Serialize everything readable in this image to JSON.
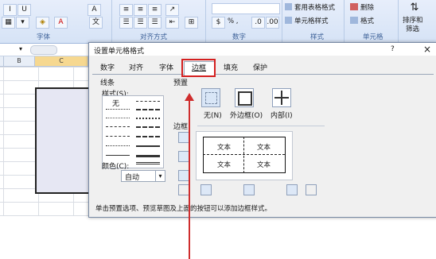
{
  "ribbon": {
    "group_font": "字体",
    "group_align": "对齐方式",
    "group_number": "数字",
    "group_style": "样式",
    "group_cells": "单元格",
    "number_symbols": "% ,",
    "table_format": "套用表格格式",
    "cell_style": "单元格样式",
    "delete": "删除",
    "format": "格式",
    "sort_filter_1": "排序和",
    "sort_filter_2": "筛选"
  },
  "sheet": {
    "name_box": "▾",
    "col_b": "B",
    "col_c": "C"
  },
  "dialog": {
    "title": "设置单元格格式",
    "help": "?",
    "close": "×",
    "tabs": [
      "数字",
      "对齐",
      "字体",
      "边框",
      "填充",
      "保护"
    ],
    "line_section": "线条",
    "style_label": "样式(S):",
    "style_none": "无",
    "color_label": "颜色(C):",
    "color_value": "自动",
    "preset_section": "预置",
    "preset_none": "无(N)",
    "preset_outline": "外边框(O)",
    "preset_inside": "内部(I)",
    "border_section": "边框",
    "preview_text": "文本",
    "hint": "单击预置选项、预览草图及上面的按钮可以添加边框样式。"
  },
  "colors": {
    "annotation": "#cf2d2d",
    "ribbon": "#dde8f7"
  }
}
